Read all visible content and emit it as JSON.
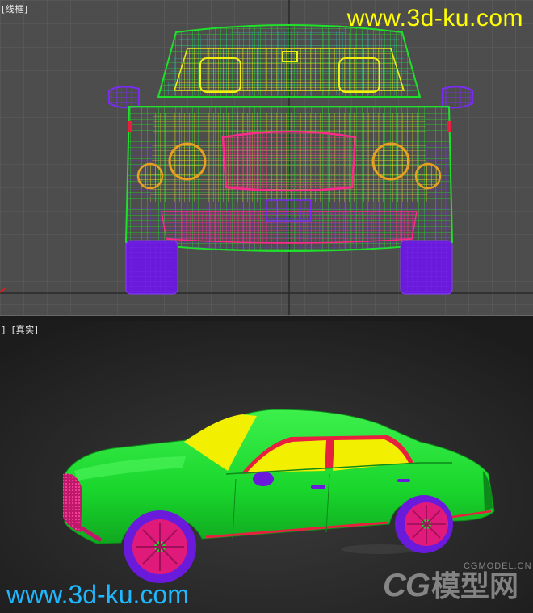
{
  "viewports": {
    "top": {
      "labels": [
        "[线框]"
      ],
      "watermark": "www.3d-ku.com"
    },
    "bottom": {
      "labels": [
        "[真实]"
      ],
      "partial_label": "]",
      "watermark": "www.3d-ku.com",
      "cg_logo": {
        "big": "CG",
        "cn": "模型网",
        "small": "CGMODEL.CN"
      }
    }
  },
  "colors": {
    "grid_bg": "#4d4d4d",
    "grid_line": "#5e5e5e",
    "body_green": "#19d62c",
    "window_yellow": "#f2ef00",
    "wheel_purple": "#6a1adb",
    "rim_pink": "#e01a7a",
    "trim_red": "#e82040",
    "watermark_yellow": "#ffff00",
    "watermark_blue": "#1fb8ff"
  }
}
